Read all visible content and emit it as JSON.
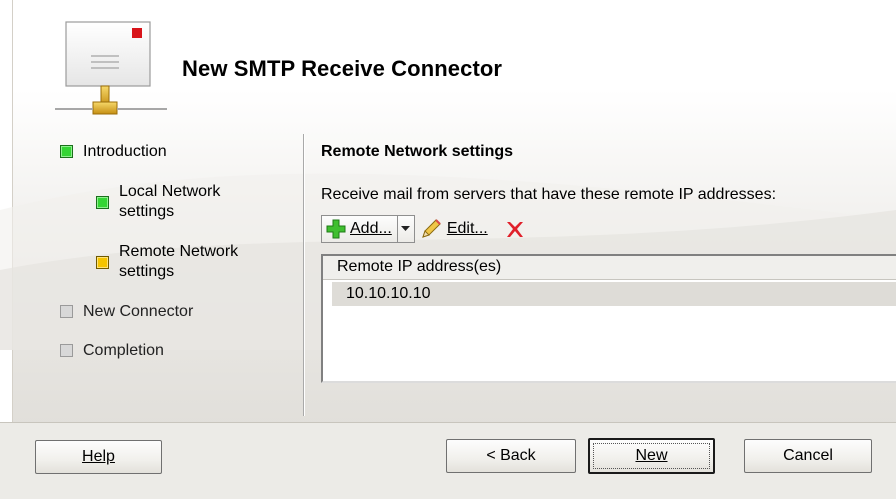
{
  "header": {
    "title": "New SMTP Receive Connector"
  },
  "nav": {
    "items": [
      {
        "label": "Introduction",
        "state": "complete",
        "color": "#34d534"
      },
      {
        "label": "Local Network settings",
        "state": "complete",
        "color": "#34d534"
      },
      {
        "label": "Remote Network settings",
        "state": "current",
        "color": "#f5c400"
      },
      {
        "label": "New Connector",
        "state": "pending",
        "color": "#d8d8d8"
      },
      {
        "label": "Completion",
        "state": "pending",
        "color": "#d8d8d8"
      }
    ]
  },
  "main": {
    "section_title": "Remote Network settings",
    "description": "Receive mail from servers that have these remote IP addresses:",
    "toolbar": {
      "add_label": "Add...",
      "edit_label": "Edit...",
      "add_icon": "plus-icon",
      "edit_icon": "pencil-icon",
      "delete_icon": "red-x-icon"
    },
    "list": {
      "column_header": "Remote IP address(es)",
      "rows": [
        "10.10.10.10"
      ]
    }
  },
  "footer": {
    "help_label": "Help",
    "back_label": "< Back",
    "new_label": "New",
    "cancel_label": "Cancel"
  }
}
